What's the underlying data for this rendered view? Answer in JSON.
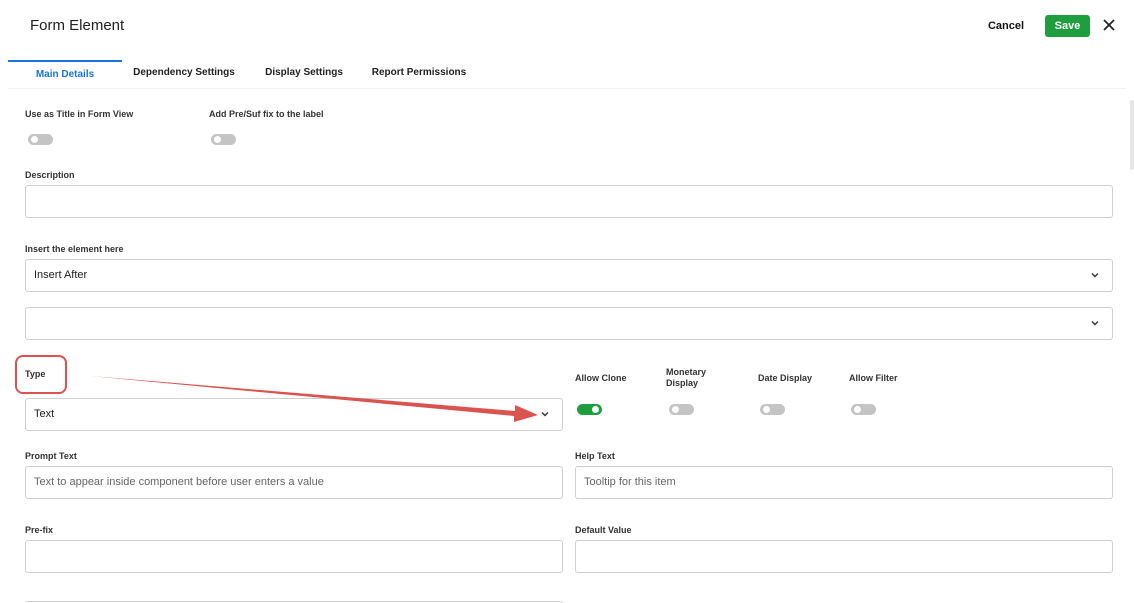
{
  "header": {
    "title": "Form Element",
    "cancel_label": "Cancel",
    "save_label": "Save"
  },
  "tabs": [
    {
      "label": "Main Details"
    },
    {
      "label": "Dependency Settings"
    },
    {
      "label": "Display Settings"
    },
    {
      "label": "Report Permissions"
    }
  ],
  "form": {
    "use_as_title": {
      "label": "Use as Title in Form View",
      "on": false
    },
    "add_prefix_suffix": {
      "label": "Add Pre/Suf fix to the label",
      "on": false
    },
    "description": {
      "label": "Description",
      "value": ""
    },
    "insert_element": {
      "label": "Insert the element here",
      "value": "Insert After"
    },
    "insert_target": {
      "value": ""
    },
    "type": {
      "label": "Type",
      "value": "Text"
    },
    "allow_clone": {
      "label": "Allow Clone",
      "on": true
    },
    "monetary_display": {
      "label_line1": "Monetary",
      "label_line2": "Display",
      "on": false
    },
    "date_display": {
      "label": "Date Display",
      "on": false
    },
    "allow_filter": {
      "label": "Allow Filter",
      "on": false
    },
    "prompt_text": {
      "label": "Prompt Text",
      "placeholder": "Text to appear inside component before user enters a value"
    },
    "help_text": {
      "label": "Help Text",
      "placeholder": "Tooltip for this item"
    },
    "prefix": {
      "label": "Pre-fix",
      "value": ""
    },
    "default_value": {
      "label": "Default Value",
      "value": ""
    }
  },
  "colors": {
    "accent": "#1a73d9",
    "save": "#1e9e3f",
    "annotation": "#d9534f"
  }
}
